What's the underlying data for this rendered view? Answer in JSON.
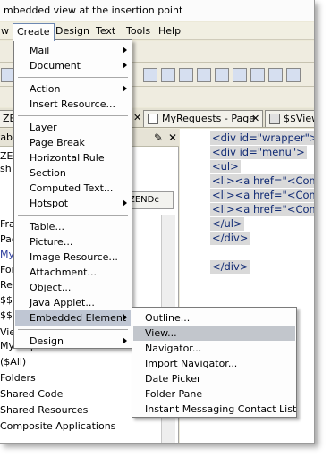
{
  "hint": {
    "text": "mbedded view at the insertion point"
  },
  "menubar": {
    "items": [
      {
        "label": "w"
      },
      {
        "label": "Create"
      },
      {
        "label": "Design"
      },
      {
        "label": "Text"
      },
      {
        "label": "Tools"
      },
      {
        "label": "Help"
      }
    ]
  },
  "tabs": [
    {
      "label": "ZE"
    },
    {
      "label": "MyRequests - Page",
      "icon": "page-icon"
    },
    {
      "label": "$$View",
      "icon": "grid-icon"
    }
  ],
  "left_pane": {
    "header_label": "tab",
    "inner_tab_label": "ZENDc",
    "items": [
      "ZE",
      "sh",
      "Fra",
      "Pag",
      "My",
      "For",
      "Re",
      "$$",
      "$$",
      "Vie",
      "MyRequestList",
      "($All)",
      "Folders",
      "Shared Code",
      "Shared Resources",
      "Composite Applications"
    ]
  },
  "code": {
    "lines": [
      {
        "text": "<div id=\"wrapper\"><",
        "highlight": true
      },
      {
        "text": "<div id=\"menu\">",
        "highlight": true
      },
      {
        "text": "<ul>",
        "highlight": true
      },
      {
        "text": "<li><a href=\"<Compu",
        "highlight": true
      },
      {
        "text": "<li><a href=\"<Compu",
        "highlight": true
      },
      {
        "text": "<li><a href=\"<Compu",
        "highlight": true
      },
      {
        "text": "</ul>",
        "highlight": true
      },
      {
        "text": "</div>",
        "highlight": true
      },
      {
        "text": "",
        "highlight": false
      },
      {
        "text": "</div>",
        "highlight": true
      }
    ]
  },
  "create_menu": {
    "items": [
      {
        "label": "Mail",
        "submenu": true
      },
      {
        "label": "Document",
        "submenu": true
      },
      {
        "sep": true
      },
      {
        "label": "Action",
        "submenu": true
      },
      {
        "label": "Insert Resource...",
        "submenu": false
      },
      {
        "sep": true
      },
      {
        "label": "Layer",
        "submenu": false
      },
      {
        "label": "Page Break",
        "submenu": false
      },
      {
        "label": "Horizontal Rule",
        "submenu": false
      },
      {
        "label": "Section",
        "submenu": false
      },
      {
        "label": "Computed Text...",
        "submenu": false
      },
      {
        "label": "Hotspot",
        "submenu": true
      },
      {
        "sep": true
      },
      {
        "label": "Table...",
        "submenu": false
      },
      {
        "label": "Picture...",
        "submenu": false
      },
      {
        "label": "Image Resource...",
        "submenu": false
      },
      {
        "label": "Attachment...",
        "submenu": false
      },
      {
        "label": "Object...",
        "submenu": false
      },
      {
        "label": "Java Applet...",
        "submenu": false
      },
      {
        "label": "Embedded Element",
        "submenu": true,
        "highlight": true
      },
      {
        "sep": true
      },
      {
        "label": "Design",
        "submenu": true
      }
    ]
  },
  "embedded_submenu": {
    "items": [
      {
        "label": "Outline..."
      },
      {
        "label": "View...",
        "highlight": true
      },
      {
        "label": "Navigator..."
      },
      {
        "label": "Import Navigator..."
      },
      {
        "label": "Date Picker"
      },
      {
        "label": "Folder Pane"
      },
      {
        "label": "Instant Messaging Contact List"
      }
    ]
  },
  "colors": {
    "highlight": "#bfc6d3",
    "code_text": "#102a74",
    "code_bg": "#d9d9d9"
  }
}
